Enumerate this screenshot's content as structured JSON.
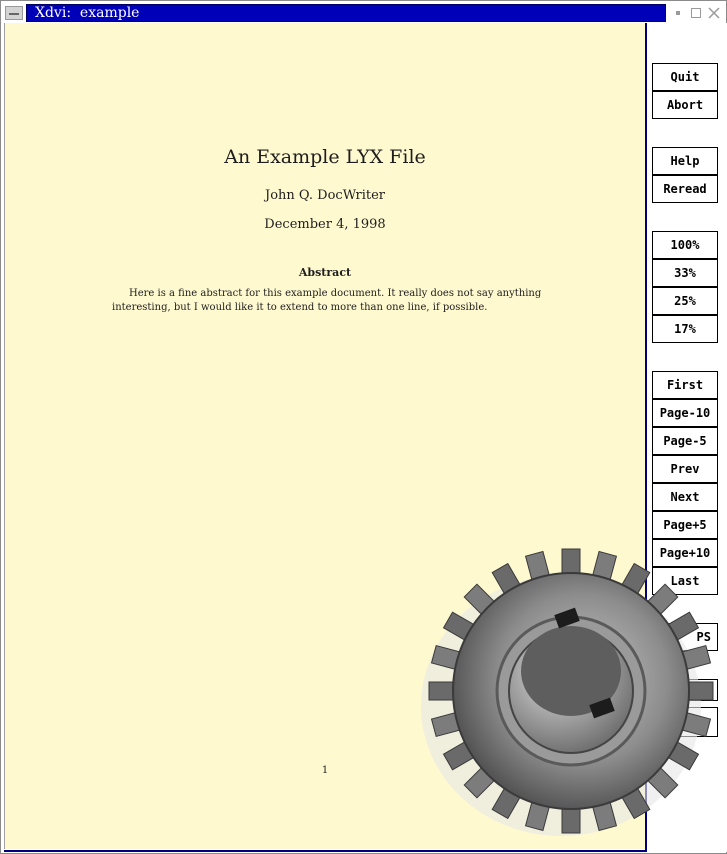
{
  "window": {
    "title": "Xdvi:  example",
    "controls": {
      "minimize_icon": "minimize-icon",
      "maximize_icon": "maximize-icon",
      "close_icon": "close-icon"
    }
  },
  "document": {
    "title": "An Example LYX File",
    "author": "John Q. DocWriter",
    "date": "December 4, 1998",
    "abstract_heading": "Abstract",
    "abstract_lines": [
      "Here is a fine abstract for this example document.  It really does not say anything",
      "interesting, but I would like it to extend to more than one line, if possible."
    ],
    "page_number": "1"
  },
  "sidebar": {
    "buttons": [
      "Quit",
      "Abort",
      "Help",
      "Reread",
      "100%",
      "33%",
      "25%",
      "17%",
      "First",
      "Page-10",
      "Page-5",
      "Prev",
      "Next",
      "Page+5",
      "Page+10",
      "Last",
      "PS"
    ]
  },
  "overlay": {
    "icon": "gear-icon"
  },
  "colors": {
    "page_background": "#fff9d0",
    "title_bar": "#0000b8"
  }
}
